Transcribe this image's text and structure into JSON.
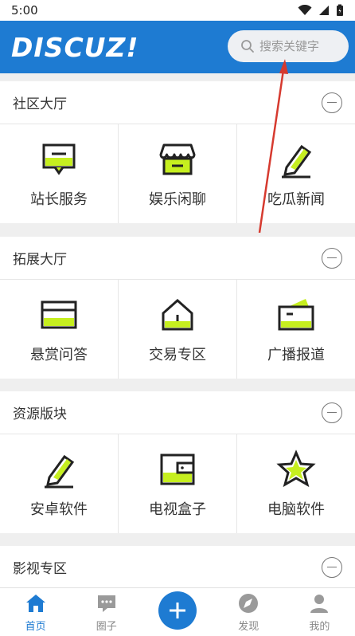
{
  "status": {
    "time": "5:00"
  },
  "header": {
    "logo": "DISCUZ!",
    "search_placeholder": "搜索关键字"
  },
  "sections": [
    {
      "title": "社区大厅",
      "items": [
        "站长服务",
        "娱乐闲聊",
        "吃瓜新闻"
      ]
    },
    {
      "title": "拓展大厅",
      "items": [
        "悬赏问答",
        "交易专区",
        "广播报道"
      ]
    },
    {
      "title": "资源版块",
      "items": [
        "安卓软件",
        "电视盒子",
        "电脑软件"
      ]
    },
    {
      "title": "影视专区",
      "items": []
    }
  ],
  "nav": {
    "home": "首页",
    "circle": "圈子",
    "add": "+",
    "discover": "发现",
    "mine": "我的"
  },
  "colors": {
    "primary": "#1e7bd2",
    "accent": "#c6ef1f",
    "annotation": "#d63a2f"
  }
}
